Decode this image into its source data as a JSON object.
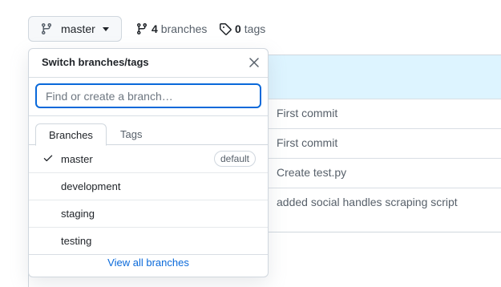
{
  "top": {
    "branch_label": "master",
    "branches_count": "4",
    "branches_label": "branches",
    "tags_count": "0",
    "tags_label": "tags"
  },
  "commits": [
    "First commit",
    "First commit",
    "Create test.py",
    "added social handles scraping script"
  ],
  "dropdown": {
    "title": "Switch branches/tags",
    "search_placeholder": "Find or create a branch…",
    "tabs": {
      "branches": "Branches",
      "tags": "Tags"
    },
    "items": [
      {
        "label": "master",
        "badge": "default",
        "selected": true
      },
      {
        "label": "development"
      },
      {
        "label": "staging"
      },
      {
        "label": "testing"
      }
    ],
    "view_all": "View all branches"
  },
  "colors": {
    "accent": "#0969da",
    "highlight": "#ddf4ff",
    "border": "#d0d7de"
  }
}
